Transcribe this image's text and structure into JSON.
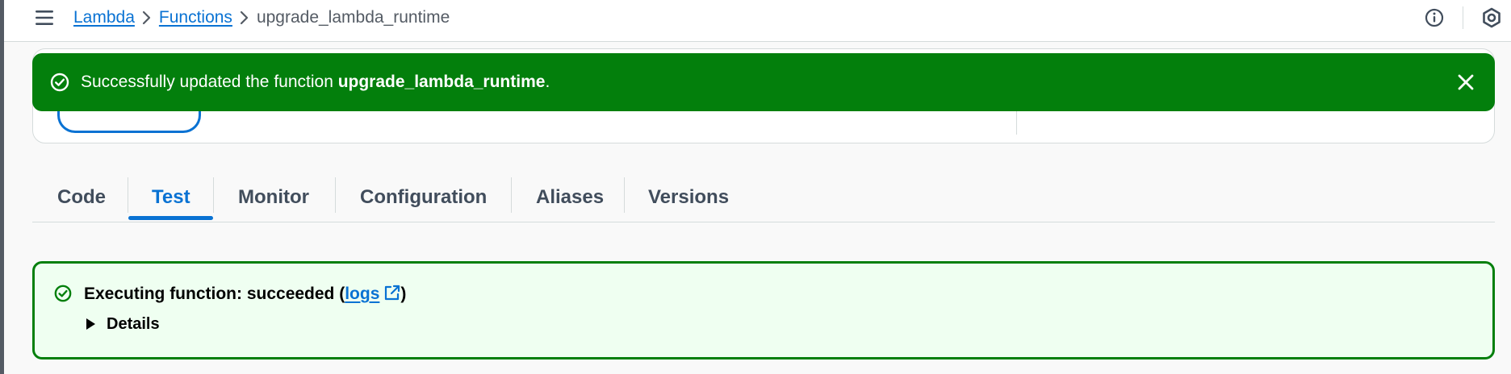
{
  "breadcrumb": {
    "items": [
      "Lambda",
      "Functions"
    ],
    "current": "upgrade_lambda_runtime"
  },
  "flash": {
    "prefix": "Successfully updated the function ",
    "function_name": "upgrade_lambda_runtime",
    "suffix": ".",
    "icon": "check-circle-icon",
    "color": "#037f0c"
  },
  "tabs": {
    "items": [
      "Code",
      "Test",
      "Monitor",
      "Configuration",
      "Aliases",
      "Versions"
    ],
    "active": "Test"
  },
  "result": {
    "title_prefix": "Executing function: succeeded (",
    "link_label": "logs",
    "title_suffix": ")",
    "details_label": "Details",
    "status_color": "#037f0c",
    "background": "#effff1"
  },
  "icons": {
    "menu": "hamburger-menu-icon",
    "info": "info-icon",
    "settings": "settings-icon",
    "close": "close-icon",
    "external": "external-link-icon",
    "caret": "caret-right-icon"
  },
  "colors": {
    "link": "#0972d3",
    "tab_active": "#0972d3",
    "tab_text": "#414d5c"
  }
}
